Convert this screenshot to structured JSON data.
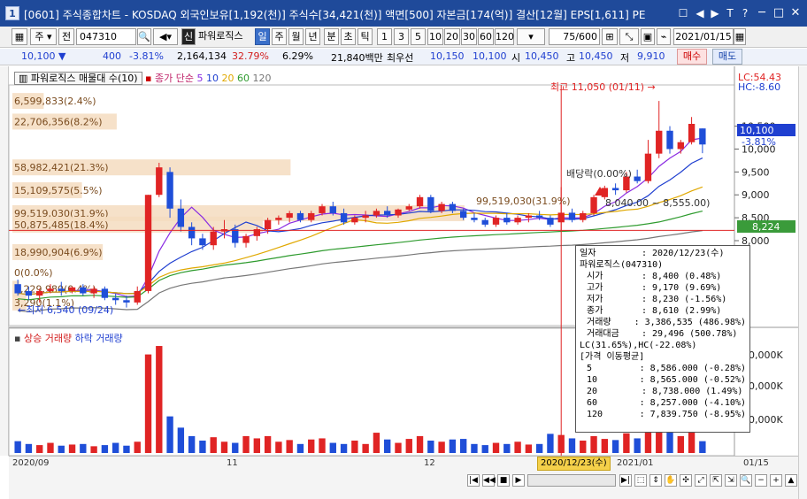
{
  "title": {
    "number": "1",
    "text": "[0601] 주식종합차트 - KOSDAQ 외국인보유[1,192(천)] 주식수[34,421(천)] 액면[500] 자본금[174(억)] 결산[12월] EPS[1,611] PE",
    "buttons": [
      "☐",
      "◀",
      "▶",
      "T",
      "?"
    ],
    "window_buttons": [
      "─",
      "□",
      "✕"
    ]
  },
  "toolbar": {
    "stock_mode": "주",
    "prev_label": "전",
    "code": "047310",
    "sin": "신",
    "name": "파워로직스",
    "periods": [
      "일",
      "주",
      "월",
      "년",
      "분",
      "초",
      "틱"
    ],
    "active_period": "일",
    "intervals": [
      "1",
      "3",
      "5",
      "10",
      "20",
      "30",
      "60",
      "120"
    ],
    "count": "75",
    "count_total": "/600",
    "date": "2021/01/15"
  },
  "quote": {
    "price": "10,100",
    "change": "400",
    "change_pct": "-3.81%",
    "volume": "2,164,134",
    "vol_ratio": "32.79%",
    "turnover": "6.29%",
    "amount": "21,840백만",
    "pref_label": "최우선",
    "bid1": "10,150",
    "bid2": "10,100",
    "open_label": "시",
    "open": "10,450",
    "high_label": "고",
    "high": "10,450",
    "low_label": "저",
    "low": "9,910",
    "buy_label": "매수",
    "sell_label": "매도"
  },
  "legend": {
    "main": "파워로직스 매물대 수(10)",
    "ma_title": "종가 단순",
    "ma_periods": [
      {
        "label": "5",
        "color": "#8a2be2"
      },
      {
        "label": "10",
        "color": "#1f3fd0"
      },
      {
        "label": "20",
        "color": "#e0a800"
      },
      {
        "label": "60",
        "color": "#2e9b2e"
      },
      {
        "label": "120",
        "color": "#777777"
      }
    ],
    "vol_up": "상승 거래량",
    "vol_down": "하락 거래량"
  },
  "colors": {
    "up": "#e02424",
    "down": "#1f4ed8",
    "ma5": "#8a2be2",
    "ma10": "#1f3fd0",
    "ma20": "#e0a800",
    "ma60": "#2e9b2e",
    "ma120": "#777777",
    "profile": "#f5dcc0",
    "accent": "#1f4a9a"
  },
  "annotations": {
    "high": "최고 11,050 (01/11)",
    "low": "최저 6,540 (09/24)",
    "ex_div": "배당락(0.00%)",
    "lc": "LC:54.43",
    "hc": "HC:-8.60",
    "cur_price": "10,100",
    "cur_pct": "-3.81%",
    "hline_price": "8,224",
    "overlay_text": "99,519,030(31.9%)",
    "overlay_text2": "8,040.00 ~ 8,555.00)"
  },
  "volume_profile": [
    {
      "label": "6,599,833(2.4%)",
      "price": 11050,
      "width_pct": 0.045
    },
    {
      "label": "22,706,356(8.2%)",
      "price": 10600,
      "width_pct": 0.15
    },
    {
      "label": "58,982,421(21.3%)",
      "price": 9600,
      "width_pct": 0.4
    },
    {
      "label": "15,109,575(5.5%)",
      "price": 9100,
      "width_pct": 0.1
    },
    {
      "label": "99,519,030(31.9%)",
      "price": 8600,
      "width_pct": 0.65
    },
    {
      "label": "50,875,485(18.4%)",
      "price": 8350,
      "width_pct": 0.36
    },
    {
      "label": "18,990,904(6.9%)",
      "price": 7750,
      "width_pct": 0.13
    },
    {
      "label": "0(0.0%)",
      "price": 7300,
      "width_pct": 0
    },
    {
      "label": "1,229,980(0.4%)",
      "price": 6950,
      "width_pct": 0.01
    },
    {
      "label": "3,290(1.1%)",
      "price": 6650,
      "width_pct": 0.02
    }
  ],
  "y_axis": {
    "ticks": [
      "10,500",
      "10,000",
      "9,500",
      "9,000",
      "8,500",
      "8,000"
    ],
    "vol_ticks": [
      "0,000K",
      "0,000K",
      "0,000K"
    ]
  },
  "x_axis": {
    "labels": [
      {
        "text": "2020/09",
        "pos": 0.0
      },
      {
        "text": "11",
        "pos": 0.3
      },
      {
        "text": "12",
        "pos": 0.57
      },
      {
        "text": "2021/01",
        "pos": 0.85
      }
    ],
    "highlight": "2020/12/23(수)",
    "right": "01/15"
  },
  "chart_data": {
    "type": "candlestick",
    "ylim": [
      6300,
      11400
    ],
    "candles": [
      {
        "o": 7050,
        "h": 7150,
        "l": 6800,
        "c": 6850
      },
      {
        "o": 6900,
        "h": 7000,
        "l": 6700,
        "c": 6800
      },
      {
        "o": 6800,
        "h": 6950,
        "l": 6650,
        "c": 6900
      },
      {
        "o": 6900,
        "h": 7050,
        "l": 6850,
        "c": 6950
      },
      {
        "o": 6950,
        "h": 7100,
        "l": 6800,
        "c": 6900
      },
      {
        "o": 6900,
        "h": 7000,
        "l": 6850,
        "c": 6980
      },
      {
        "o": 6980,
        "h": 7050,
        "l": 6800,
        "c": 6850
      },
      {
        "o": 6850,
        "h": 7000,
        "l": 6750,
        "c": 6950
      },
      {
        "o": 6950,
        "h": 7000,
        "l": 6700,
        "c": 6750
      },
      {
        "o": 6750,
        "h": 6850,
        "l": 6600,
        "c": 6700
      },
      {
        "o": 6700,
        "h": 6800,
        "l": 6540,
        "c": 6650
      },
      {
        "o": 6650,
        "h": 7000,
        "l": 6600,
        "c": 6900
      },
      {
        "o": 6900,
        "h": 9000,
        "l": 6850,
        "c": 9000
      },
      {
        "o": 9000,
        "h": 9700,
        "l": 8950,
        "c": 9600
      },
      {
        "o": 9500,
        "h": 9600,
        "l": 8500,
        "c": 8700
      },
      {
        "o": 8700,
        "h": 8900,
        "l": 8200,
        "c": 8300
      },
      {
        "o": 8300,
        "h": 8400,
        "l": 7900,
        "c": 8050
      },
      {
        "o": 8050,
        "h": 8150,
        "l": 7800,
        "c": 7900
      },
      {
        "o": 7900,
        "h": 8300,
        "l": 7800,
        "c": 8200
      },
      {
        "o": 8200,
        "h": 8450,
        "l": 8050,
        "c": 8250
      },
      {
        "o": 8250,
        "h": 8350,
        "l": 7850,
        "c": 7950
      },
      {
        "o": 7950,
        "h": 8150,
        "l": 7850,
        "c": 8100
      },
      {
        "o": 8100,
        "h": 8300,
        "l": 8000,
        "c": 8250
      },
      {
        "o": 8250,
        "h": 8500,
        "l": 8150,
        "c": 8450
      },
      {
        "o": 8450,
        "h": 8550,
        "l": 8350,
        "c": 8500
      },
      {
        "o": 8500,
        "h": 8650,
        "l": 8400,
        "c": 8600
      },
      {
        "o": 8600,
        "h": 8650,
        "l": 8400,
        "c": 8450
      },
      {
        "o": 8450,
        "h": 8650,
        "l": 8400,
        "c": 8600
      },
      {
        "o": 8600,
        "h": 8800,
        "l": 8550,
        "c": 8750
      },
      {
        "o": 8750,
        "h": 8850,
        "l": 8550,
        "c": 8600
      },
      {
        "o": 8600,
        "h": 8700,
        "l": 8350,
        "c": 8400
      },
      {
        "o": 8400,
        "h": 8550,
        "l": 8350,
        "c": 8500
      },
      {
        "o": 8500,
        "h": 8650,
        "l": 8400,
        "c": 8550
      },
      {
        "o": 8550,
        "h": 8700,
        "l": 8500,
        "c": 8650
      },
      {
        "o": 8650,
        "h": 8750,
        "l": 8500,
        "c": 8550
      },
      {
        "o": 8550,
        "h": 8700,
        "l": 8500,
        "c": 8680
      },
      {
        "o": 8680,
        "h": 8800,
        "l": 8650,
        "c": 8750
      },
      {
        "o": 8750,
        "h": 9000,
        "l": 8700,
        "c": 8950
      },
      {
        "o": 8950,
        "h": 9000,
        "l": 8600,
        "c": 8650
      },
      {
        "o": 8650,
        "h": 8850,
        "l": 8600,
        "c": 8800
      },
      {
        "o": 8800,
        "h": 8850,
        "l": 8600,
        "c": 8650
      },
      {
        "o": 8650,
        "h": 8700,
        "l": 8450,
        "c": 8500
      },
      {
        "o": 8500,
        "h": 8600,
        "l": 8400,
        "c": 8450
      },
      {
        "o": 8450,
        "h": 8500,
        "l": 8300,
        "c": 8350
      },
      {
        "o": 8350,
        "h": 8550,
        "l": 8300,
        "c": 8500
      },
      {
        "o": 8500,
        "h": 8600,
        "l": 8350,
        "c": 8400
      },
      {
        "o": 8400,
        "h": 8550,
        "l": 8350,
        "c": 8500
      },
      {
        "o": 8500,
        "h": 8600,
        "l": 8400,
        "c": 8550
      },
      {
        "o": 8550,
        "h": 8650,
        "l": 8450,
        "c": 8500
      },
      {
        "o": 8500,
        "h": 8550,
        "l": 8300,
        "c": 8350
      },
      {
        "o": 8400,
        "h": 9170,
        "l": 8230,
        "c": 8610
      },
      {
        "o": 8610,
        "h": 8700,
        "l": 8400,
        "c": 8450
      },
      {
        "o": 8450,
        "h": 8650,
        "l": 8400,
        "c": 8600
      },
      {
        "o": 8600,
        "h": 9000,
        "l": 8550,
        "c": 8950
      },
      {
        "o": 8950,
        "h": 9200,
        "l": 8900,
        "c": 9150
      },
      {
        "o": 9150,
        "h": 9250,
        "l": 9000,
        "c": 9100
      },
      {
        "o": 9100,
        "h": 9500,
        "l": 9050,
        "c": 9400
      },
      {
        "o": 9400,
        "h": 9550,
        "l": 9250,
        "c": 9300
      },
      {
        "o": 9300,
        "h": 10200,
        "l": 9250,
        "c": 9900
      },
      {
        "o": 9900,
        "h": 11050,
        "l": 9800,
        "c": 10400
      },
      {
        "o": 10400,
        "h": 10500,
        "l": 9900,
        "c": 10000
      },
      {
        "o": 10000,
        "h": 10200,
        "l": 9900,
        "c": 10150
      },
      {
        "o": 10150,
        "h": 10700,
        "l": 10100,
        "c": 10550
      },
      {
        "o": 10450,
        "h": 10450,
        "l": 9910,
        "c": 10100
      }
    ],
    "volume": [
      2.1,
      1.6,
      1.4,
      1.8,
      1.3,
      1.5,
      1.6,
      1.2,
      1.4,
      1.8,
      1.3,
      2.0,
      17.5,
      19.0,
      6.5,
      4.5,
      3.0,
      2.2,
      2.8,
      2.0,
      1.8,
      3.0,
      2.6,
      3.0,
      2.0,
      2.3,
      1.6,
      2.4,
      2.6,
      1.8,
      1.6,
      2.2,
      1.6,
      3.6,
      2.4,
      1.8,
      2.5,
      3.0,
      2.2,
      2.0,
      2.4,
      2.5,
      1.6,
      1.4,
      1.8,
      1.6,
      2.0,
      1.5,
      1.6,
      3.4,
      3.2,
      2.6,
      2.2,
      3.0,
      2.5,
      2.3,
      3.5,
      2.6,
      4.0,
      6.5,
      4.0,
      3.0,
      4.2,
      2.1
    ],
    "volume_unit": "relative"
  },
  "info": {
    "rows": [
      {
        "k": "일자",
        "v": ": 2020/12/23(수)"
      },
      {
        "k": "파워로직스(047310)",
        "v": ""
      }
    ],
    "price_rows": [
      {
        "k": "시가",
        "v": ": 8,400 (0.48%)"
      },
      {
        "k": "고가",
        "v": ": 9,170 (9.69%)"
      },
      {
        "k": "저가",
        "v": ": 8,230 (-1.56%)"
      },
      {
        "k": "종가",
        "v": ": 8,610 (2.99%)"
      },
      {
        "k": "거래량",
        "v": ": 3,386,535 (486.98%)"
      },
      {
        "k": "거래대금",
        "v": ": 29,496 (500.78%)"
      }
    ],
    "lchc": "LC(31.65%),HC(-22.08%)",
    "ma_title": "[가격 이동평균]",
    "ma_rows": [
      {
        "k": "5",
        "v": ": 8,586.000 (-0.28%)"
      },
      {
        "k": "10",
        "v": ": 8,565.000 (-0.52%)"
      },
      {
        "k": "20",
        "v": ": 8,738.000 (1.49%)"
      },
      {
        "k": "60",
        "v": ": 8,257.000 (-4.10%)"
      },
      {
        "k": "120",
        "v": ": 7,839.750 (-8.95%)"
      }
    ]
  }
}
